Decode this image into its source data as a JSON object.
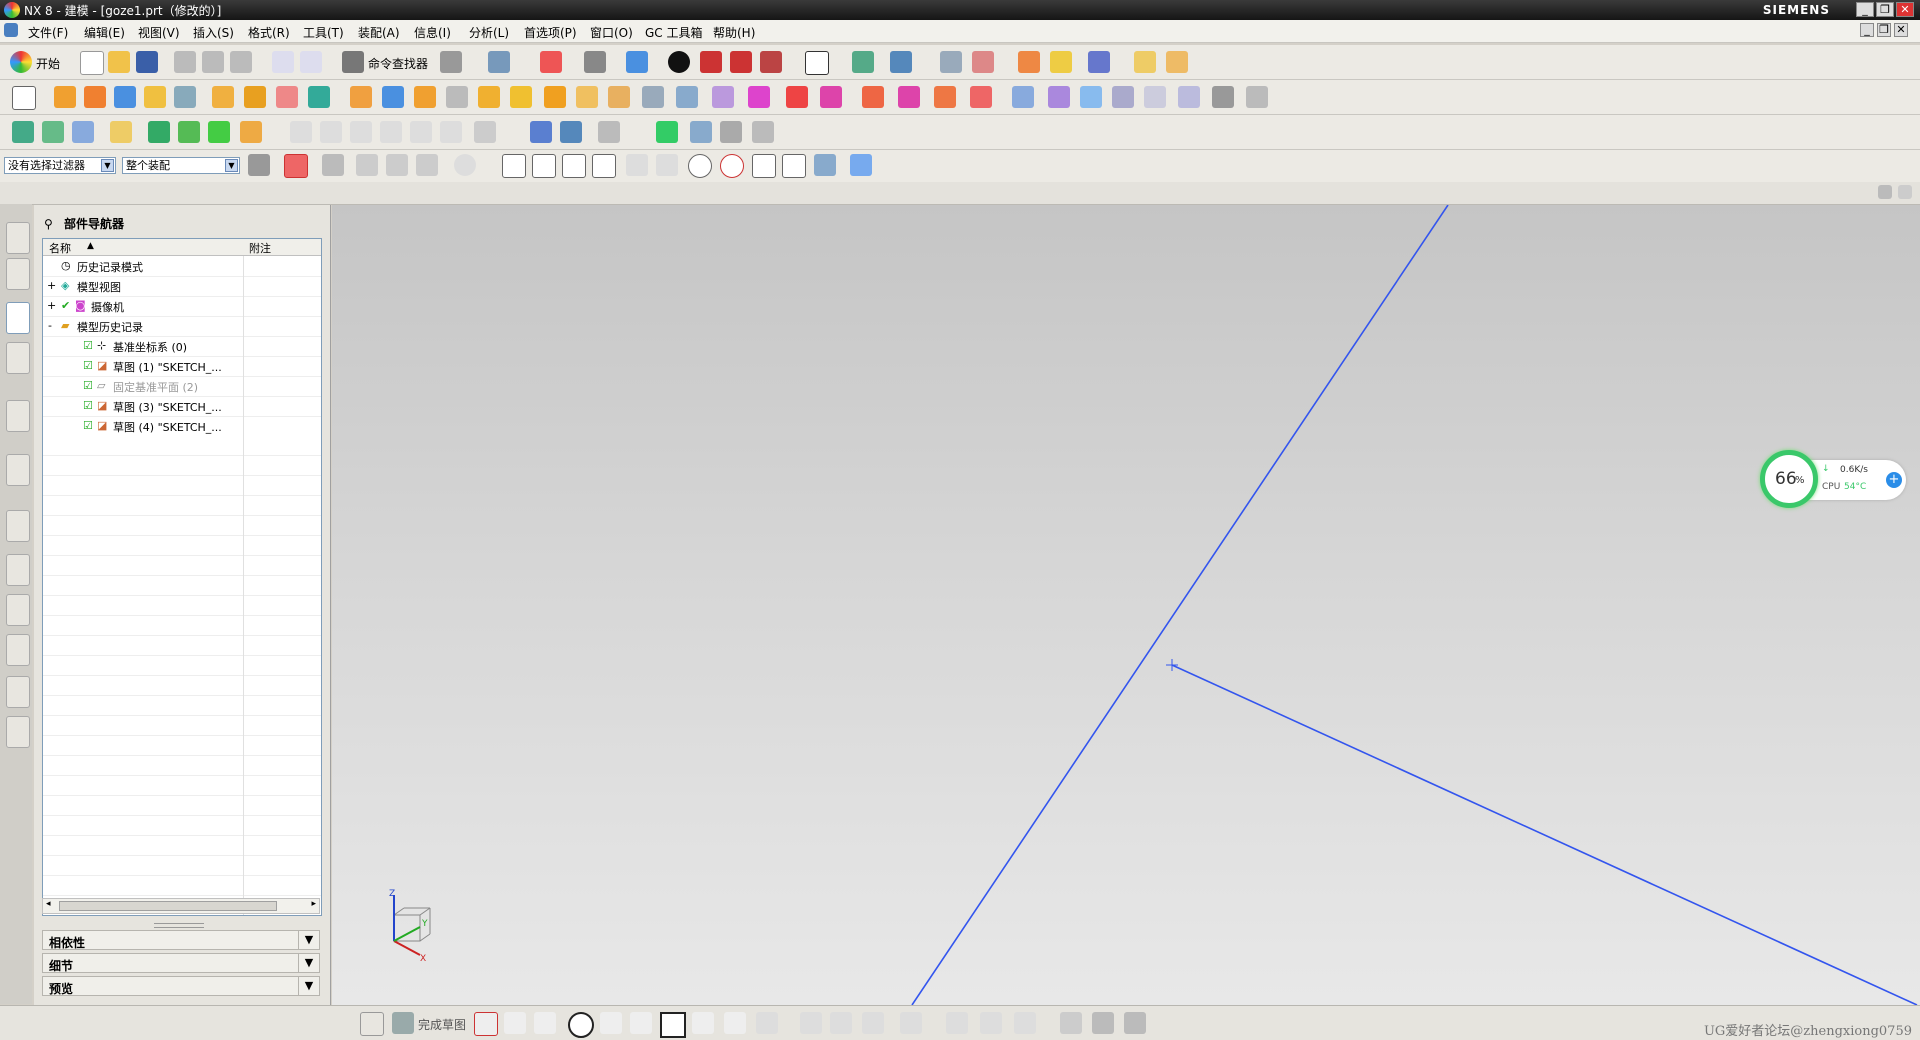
{
  "window": {
    "title": "NX 8 - 建模 - [goze1.prt（修改的）]",
    "brand": "SIEMENS"
  },
  "menu": [
    "文件(F)",
    "编辑(E)",
    "视图(V)",
    "插入(S)",
    "格式(R)",
    "工具(T)",
    "装配(A)",
    "信息(I)",
    "分析(L)",
    "首选项(P)",
    "窗口(O)",
    "GC 工具箱",
    "帮助(H)"
  ],
  "toolbar": {
    "start_label": "开始",
    "command_finder_label": "命令查找器"
  },
  "selection": {
    "filter_value": "没有选择过滤器",
    "scope_value": "整个装配"
  },
  "navigator": {
    "title": "部件导航器",
    "col_name": "名称",
    "col_note": "附注",
    "items": [
      {
        "label": "历史记录模式",
        "level": 0,
        "expand": "",
        "check": false,
        "dim": false
      },
      {
        "label": "模型视图",
        "level": 0,
        "expand": "+",
        "check": false,
        "dim": false
      },
      {
        "label": "摄像机",
        "level": 0,
        "expand": "+",
        "check": true,
        "dim": false
      },
      {
        "label": "模型历史记录",
        "level": 0,
        "expand": "-",
        "check": false,
        "dim": false
      },
      {
        "label": "基准坐标系 (0)",
        "level": 1,
        "expand": "",
        "check": true,
        "dim": false
      },
      {
        "label": "草图 (1) \"SKETCH_...",
        "level": 1,
        "expand": "",
        "check": true,
        "dim": false
      },
      {
        "label": "固定基准平面 (2)",
        "level": 1,
        "expand": "",
        "check": true,
        "dim": true
      },
      {
        "label": "草图 (3) \"SKETCH_...",
        "level": 1,
        "expand": "",
        "check": true,
        "dim": false
      },
      {
        "label": "草图 (4) \"SKETCH_...",
        "level": 1,
        "expand": "",
        "check": true,
        "dim": false
      }
    ],
    "panels": [
      "相依性",
      "细节",
      "预览"
    ]
  },
  "viewport": {
    "triad": {
      "z": "Z",
      "y": "Y",
      "x": "X"
    },
    "line_color": "#3355ee"
  },
  "cpu_widget": {
    "percent": "66",
    "percent_unit": "%",
    "net_speed": "0.6K/s",
    "cpu_label": "CPU",
    "temp": "54°C"
  },
  "sketch_bar": {
    "finish_label": "完成草图"
  },
  "watermark": "UG爱好者论坛@zhengxiong0759"
}
